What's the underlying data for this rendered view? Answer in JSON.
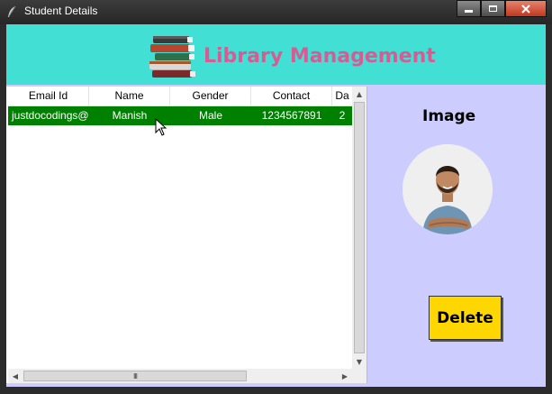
{
  "window": {
    "title": "Student Details",
    "icon": "feather-icon",
    "controls": [
      "minimize-icon",
      "maximize-icon",
      "close-icon"
    ]
  },
  "header": {
    "title": "Library Management",
    "logo_icon": "books-icon",
    "background": "#42e0d4",
    "title_color": "#d65c93"
  },
  "table": {
    "columns": [
      "Email Id",
      "Name",
      "Gender",
      "Contact",
      "Da"
    ],
    "rows": [
      {
        "cells": [
          "justdocodings@",
          "Manish",
          "Male",
          "1234567891",
          "2"
        ],
        "selected": true
      }
    ],
    "selected_row_color": "#008000"
  },
  "side_panel": {
    "image_label": "Image",
    "avatar_icon": "person-photo",
    "delete_label": "Delete",
    "background": "#ccccff",
    "delete_color": "#ffd700"
  },
  "scrollbars": {
    "horizontal_thumb_glyph": "III"
  }
}
